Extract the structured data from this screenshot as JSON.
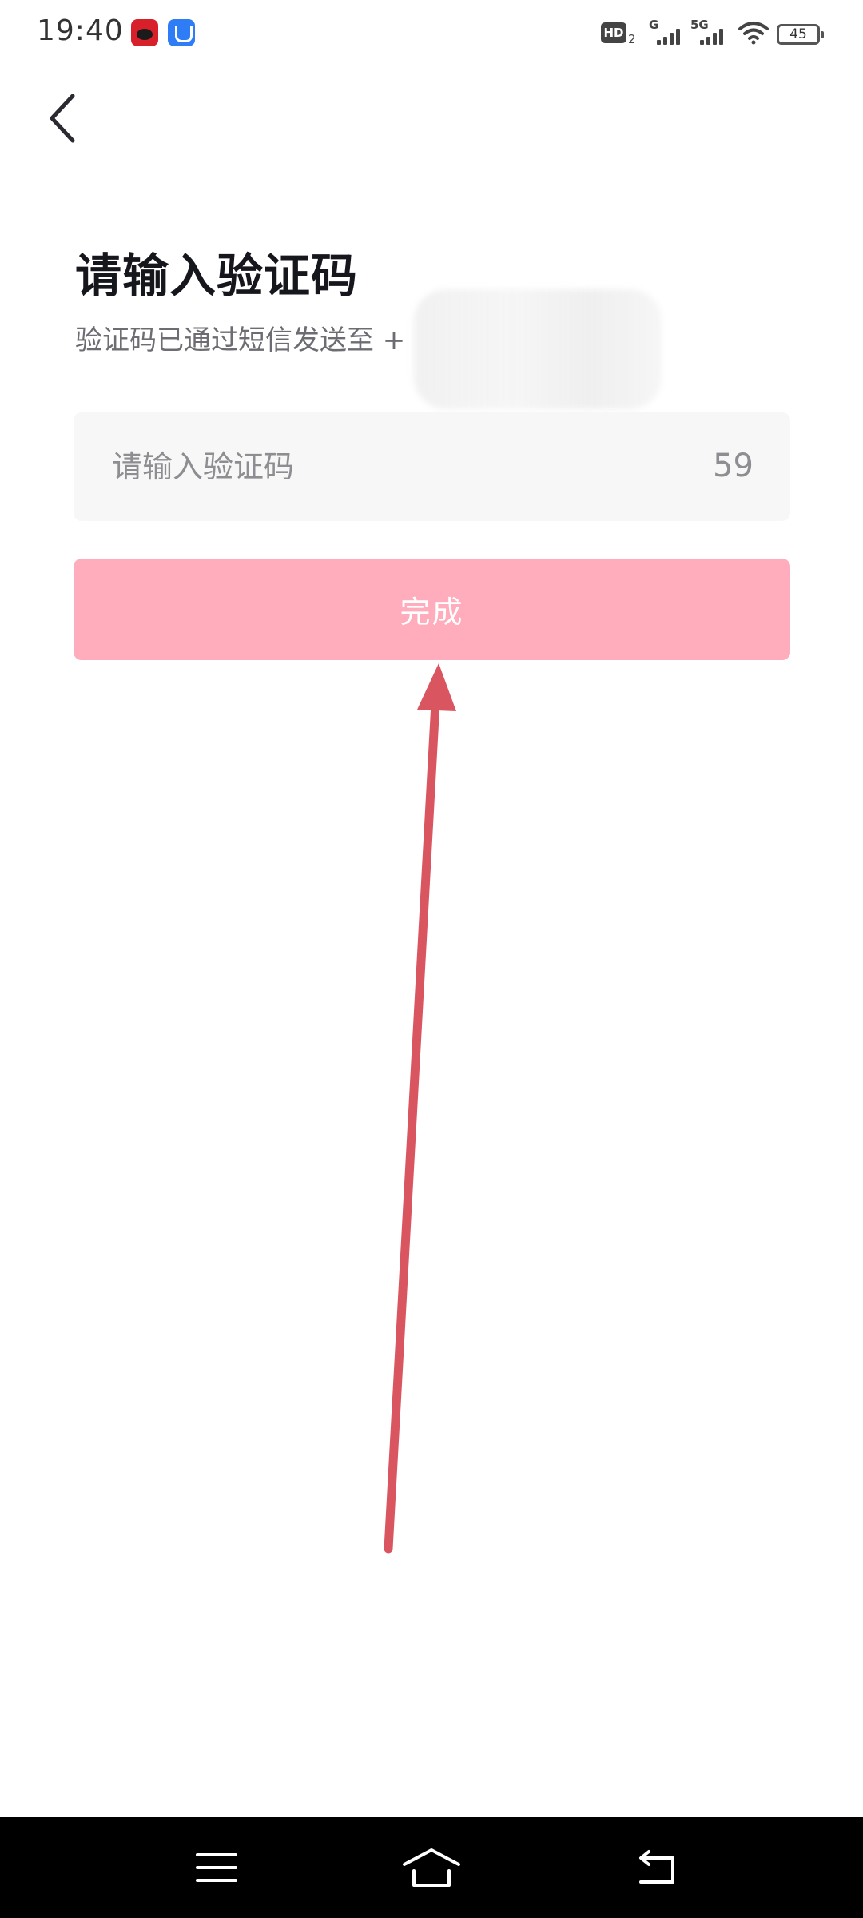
{
  "status_bar": {
    "time": "19:40",
    "hd_label": "HD",
    "hd_sub": "2",
    "network_1": "G",
    "network_2": "5G",
    "battery": "45",
    "icons": [
      "app-notification-icon",
      "app-notification-icon-2",
      "hd-voice-icon",
      "signal-icon",
      "signal-icon",
      "wifi-icon",
      "battery-icon"
    ]
  },
  "header": {
    "back_icon": "chevron-left-icon"
  },
  "main": {
    "title": "请输入验证码",
    "subtitle": "验证码已通过短信发送至 +"
  },
  "code_input": {
    "placeholder": "请输入验证码",
    "value": "",
    "countdown": "59"
  },
  "done_button": {
    "label": "完成",
    "color": "#ffadbc"
  },
  "annotation": {
    "color": "#d95560",
    "icon": "arrow-annotation"
  },
  "nav_bar": {
    "items": [
      "menu-icon",
      "home-icon",
      "back-icon"
    ]
  }
}
